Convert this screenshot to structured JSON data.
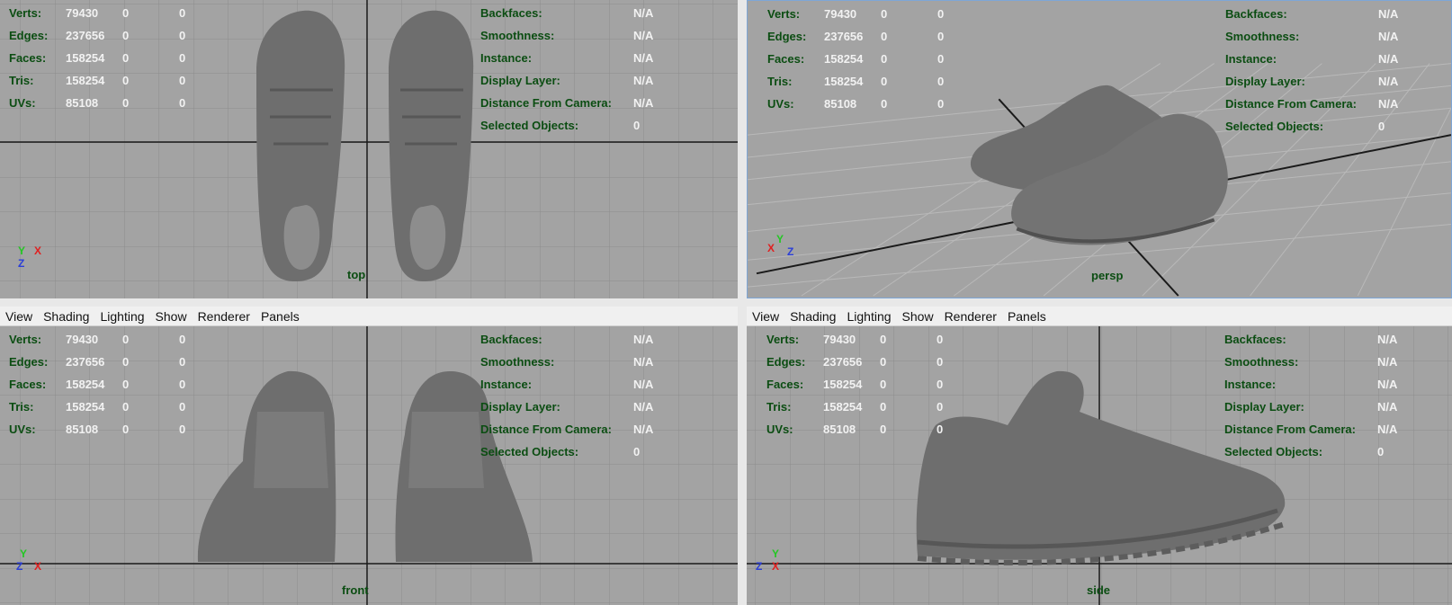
{
  "menu": [
    "View",
    "Shading",
    "Lighting",
    "Show",
    "Renderer",
    "Panels"
  ],
  "hud_stats": [
    {
      "label": "Verts:",
      "v1": "79430",
      "v2": "0",
      "v3": "0"
    },
    {
      "label": "Edges:",
      "v1": "237656",
      "v2": "0",
      "v3": "0"
    },
    {
      "label": "Faces:",
      "v1": "158254",
      "v2": "0",
      "v3": "0"
    },
    {
      "label": "Tris:",
      "v1": "158254",
      "v2": "0",
      "v3": "0"
    },
    {
      "label": "UVs:",
      "v1": "85108",
      "v2": "0",
      "v3": "0"
    }
  ],
  "hud_info": [
    {
      "label": "Backfaces:",
      "value": "N/A"
    },
    {
      "label": "Smoothness:",
      "value": "N/A"
    },
    {
      "label": "Instance:",
      "value": "N/A"
    },
    {
      "label": "Display Layer:",
      "value": "N/A"
    },
    {
      "label": "Distance From Camera:",
      "value": "N/A"
    },
    {
      "label": "Selected Objects:",
      "value": "0"
    }
  ],
  "viewports": {
    "top": {
      "camera": "top"
    },
    "persp": {
      "camera": "persp"
    },
    "front": {
      "camera": "front"
    },
    "side": {
      "camera": "side"
    }
  },
  "axes": {
    "x": "X",
    "y": "Y",
    "z": "Z"
  },
  "colors": {
    "viewport_bg": "#a3a3a3",
    "grid": "#8c8c8c",
    "axis_line": "#1a1a1a",
    "hud_label": "#0b4d12",
    "hud_value": "#f2f2f2",
    "model": "#6e6e6e"
  }
}
